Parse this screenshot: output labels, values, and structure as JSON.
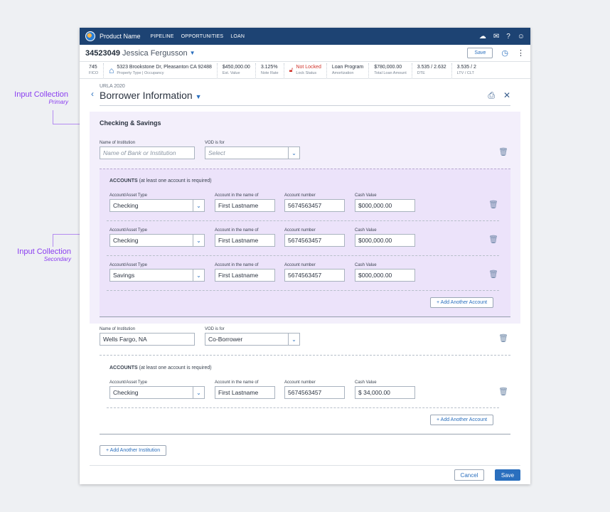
{
  "annotations": {
    "primary": {
      "title": "Input Collection",
      "sub": "Primary"
    },
    "secondary": {
      "title": "Input Collection",
      "sub": "Secondary"
    }
  },
  "topbar": {
    "product": "Product Name",
    "nav": [
      "PIPELINE",
      "OPPORTUNITIES",
      "LOAN"
    ],
    "icons": [
      "cloud-icon",
      "mail-icon",
      "help-icon",
      "user-icon"
    ]
  },
  "loan": {
    "number": "34523049",
    "borrower": "Jessica Fergusson",
    "save_label": "Save"
  },
  "stats": [
    {
      "value": "745",
      "label": "FICO"
    },
    {
      "value": "5323 Brookstone Dr, Pleasanton CA 92488",
      "label": "Property Type | Occupancy"
    },
    {
      "value": "$450,000.00",
      "label": "Est. Value"
    },
    {
      "value": "3.125%",
      "label": "Note Rate"
    },
    {
      "value": "Not Locked",
      "label": "Lock Status"
    },
    {
      "value": "Loan Program",
      "label": "Amortization"
    },
    {
      "value": "$780,000.00",
      "label": "Total Loan Amount"
    },
    {
      "value": "3.535 / 2.632",
      "label": "DTE"
    },
    {
      "value": "3.535 / 2",
      "label": "LTV / CLT"
    }
  ],
  "form": {
    "section_sup": "URLA 2020",
    "title": "Borrower Information",
    "subsection": "Checking & Savings",
    "institution_label": "Name of Institution",
    "vod_label": "VOD is for",
    "accounts_title": "ACCOUNTS",
    "accounts_note": "(at least one account is required)",
    "col_type": "Account/Asset Type",
    "col_name": "Account in the name of",
    "col_number": "Account number",
    "col_value": "Cash Value",
    "add_account": "+ Add Another Account",
    "add_institution": "+ Add Another Institution",
    "cancel": "Cancel",
    "save": "Save"
  },
  "institutions": [
    {
      "name_placeholder": "Name of Bank or Institution",
      "vod_placeholder": "Select",
      "accounts": [
        {
          "type": "Checking",
          "holder": "First Lastname",
          "number": "5674563457",
          "value": "$000,000.00"
        },
        {
          "type": "Checking",
          "holder": "First Lastname",
          "number": "5674563457",
          "value": "$000,000.00"
        },
        {
          "type": "Savings",
          "holder": "First Lastname",
          "number": "5674563457",
          "value": "$000,000.00"
        }
      ]
    },
    {
      "name": "Wells Fargo, NA",
      "vod": "Co-Borrower",
      "accounts": [
        {
          "type": "Checking",
          "holder": "First Lastname",
          "number": "5674563457",
          "value": "$ 34,000.00"
        }
      ]
    }
  ]
}
